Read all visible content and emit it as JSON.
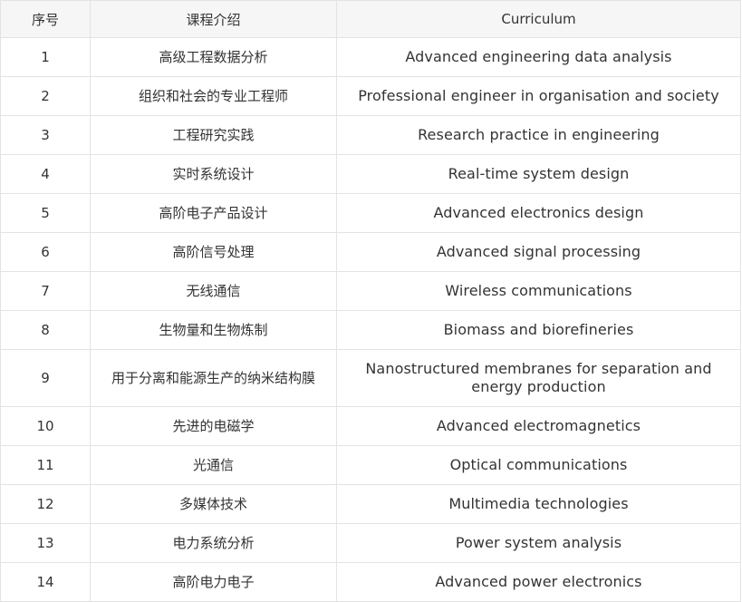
{
  "table": {
    "headers": {
      "number": "序号",
      "chinese": "课程介绍",
      "english": "Curriculum"
    },
    "rows": [
      {
        "number": "1",
        "chinese": "高级工程数据分析",
        "english": "Advanced engineering data analysis"
      },
      {
        "number": "2",
        "chinese": "组织和社会的专业工程师",
        "english": "Professional engineer in organisation and society"
      },
      {
        "number": "3",
        "chinese": "工程研究实践",
        "english": "Research practice in engineering"
      },
      {
        "number": "4",
        "chinese": "实时系统设计",
        "english": "Real-time system design"
      },
      {
        "number": "5",
        "chinese": "高阶电子产品设计",
        "english": "Advanced electronics design"
      },
      {
        "number": "6",
        "chinese": "高阶信号处理",
        "english": "Advanced signal processing"
      },
      {
        "number": "7",
        "chinese": "无线通信",
        "english": "Wireless communications"
      },
      {
        "number": "8",
        "chinese": "生物量和生物炼制",
        "english": "Biomass and biorefineries"
      },
      {
        "number": "9",
        "chinese": "用于分离和能源生产的纳米结构膜",
        "english": "Nanostructured membranes for separation and energy production"
      },
      {
        "number": "10",
        "chinese": "先进的电磁学",
        "english": "Advanced electromagnetics"
      },
      {
        "number": "11",
        "chinese": "光通信",
        "english": "Optical communications"
      },
      {
        "number": "12",
        "chinese": "多媒体技术",
        "english": "Multimedia technologies"
      },
      {
        "number": "13",
        "chinese": "电力系统分析",
        "english": "Power system analysis"
      },
      {
        "number": "14",
        "chinese": "高阶电力电子",
        "english": "Advanced power electronics"
      }
    ]
  }
}
